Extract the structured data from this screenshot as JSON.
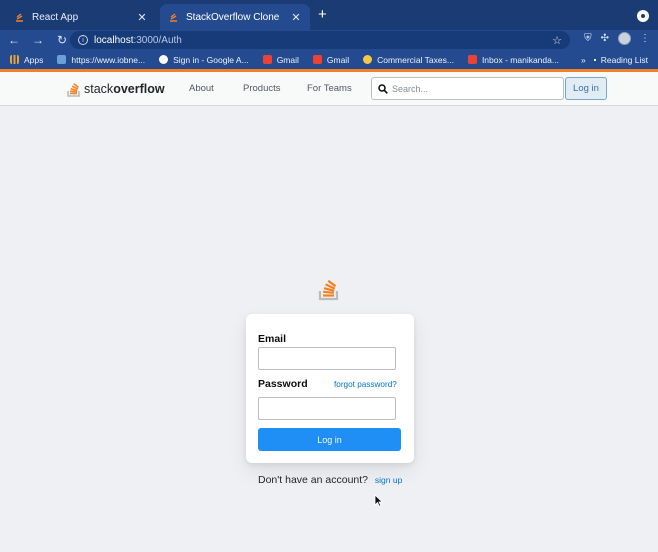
{
  "browser": {
    "tabs": [
      {
        "title": "React App",
        "active": false
      },
      {
        "title": "StackOverflow Clone",
        "active": true
      }
    ],
    "new_tab": "+",
    "url_host": "localhost",
    "url_path": ":3000/Auth",
    "bookmarks": [
      {
        "label": "Apps",
        "color": "#e8a33c"
      },
      {
        "label": "https://www.iobne...",
        "color": "#6aa0d8"
      },
      {
        "label": "Sign in - Google A...",
        "color": "#ffffff"
      },
      {
        "label": "Gmail",
        "color": "#ea4335"
      },
      {
        "label": "Gmail",
        "color": "#ea4335"
      },
      {
        "label": "Commercial Taxes...",
        "color": "#f2c94c"
      },
      {
        "label": "Inbox - manikanda...",
        "color": "#ea4335"
      }
    ],
    "bookmarks_more": "»",
    "reading_list": "Reading List"
  },
  "header": {
    "logo_part1": "stack",
    "logo_part2": "overflow",
    "nav": [
      "About",
      "Products",
      "For Teams"
    ],
    "search_placeholder": "Search...",
    "login_label": "Log in"
  },
  "auth": {
    "email_label": "Email",
    "email_value": "",
    "password_label": "Password",
    "password_value": "",
    "forgot_label": "forgot password?",
    "submit_label": "Log in",
    "no_account_text": "Don't have an account?",
    "signup_label": "sign up"
  },
  "colors": {
    "accent": "#f48024",
    "link": "#0074cc",
    "primary_button": "#1f8ff5",
    "browser_chrome": "#244a8f"
  }
}
